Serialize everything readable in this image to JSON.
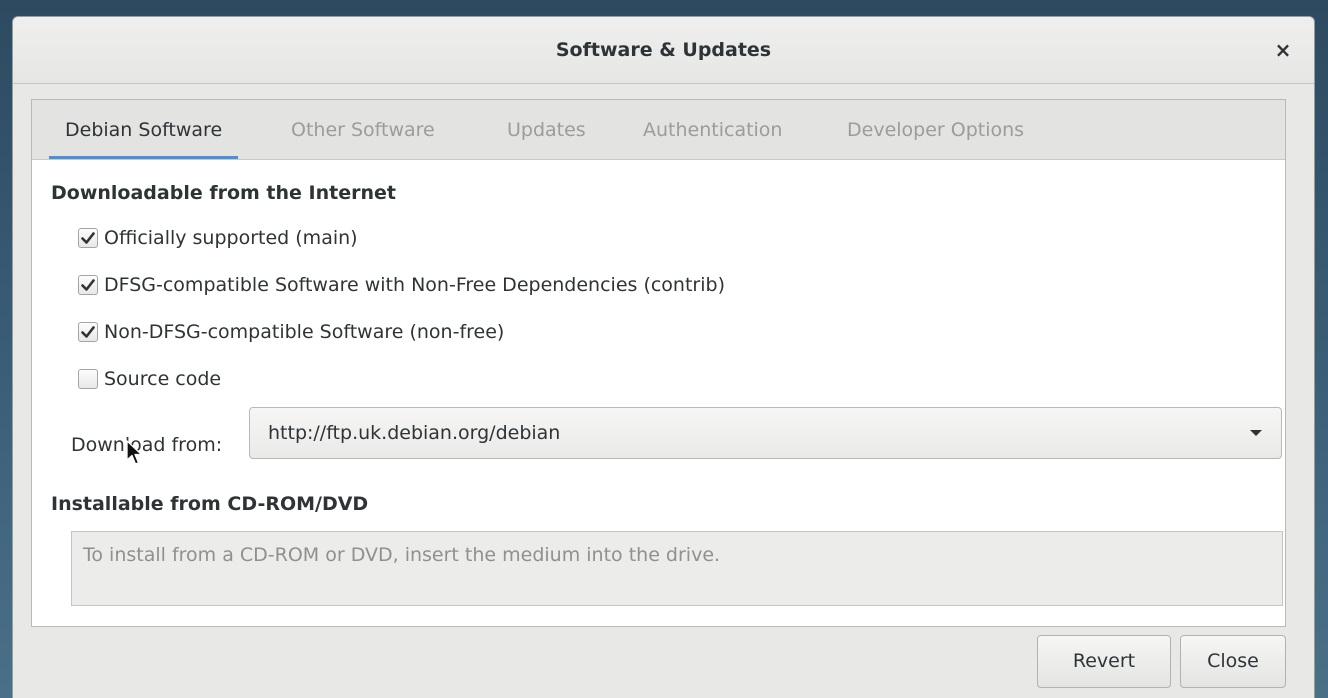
{
  "window": {
    "title": "Software & Updates",
    "close_glyph": "×"
  },
  "tabs": [
    {
      "label": "Debian Software",
      "active": true
    },
    {
      "label": "Other Software",
      "active": false
    },
    {
      "label": "Updates",
      "active": false
    },
    {
      "label": "Authentication",
      "active": false
    },
    {
      "label": "Developer Options",
      "active": false
    }
  ],
  "downloadable": {
    "heading": "Downloadable from the Internet",
    "options": [
      {
        "label": "Officially supported (main)",
        "checked": true
      },
      {
        "label": "DFSG-compatible Software with Non-Free Dependencies (contrib)",
        "checked": true
      },
      {
        "label": "Non-DFSG-compatible Software (non-free)",
        "checked": true
      },
      {
        "label": "Source code",
        "checked": false
      }
    ],
    "download_from_label": "Download from:",
    "download_from_value": "http://ftp.uk.debian.org/debian"
  },
  "cdrom": {
    "heading": "Installable from CD-ROM/DVD",
    "message": "To install from a CD-ROM or DVD, insert the medium into the drive."
  },
  "buttons": {
    "revert": "Revert",
    "close": "Close"
  },
  "icons": {
    "checkmark": "checkmark-icon",
    "dropdown": "dropdown-arrow-icon",
    "close": "close-icon",
    "pointer": "mouse-pointer-icon"
  },
  "colors": {
    "accent": "#4a90d9",
    "text": "#2e3436",
    "inactive_text": "#9b9d9a"
  }
}
